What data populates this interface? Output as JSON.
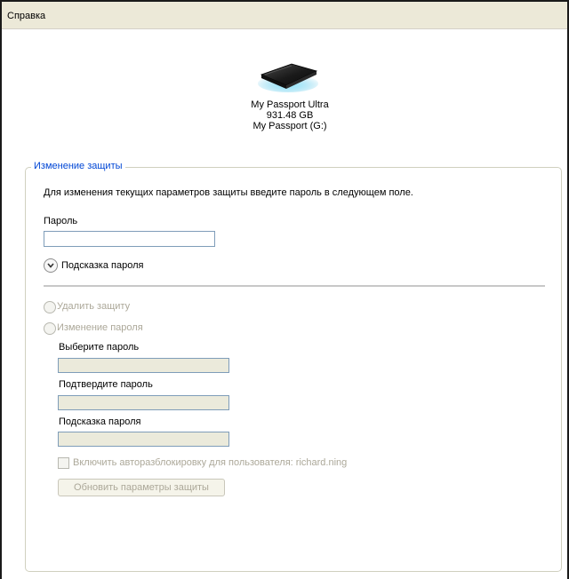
{
  "menu": {
    "help_label": "Справка"
  },
  "device": {
    "model": "My Passport Ultra",
    "capacity": "931.48 GB",
    "volume": "My Passport (G:)"
  },
  "security": {
    "group_title": "Изменение защиты",
    "instruction": "Для изменения текущих параметров защиты введите пароль в следующем поле.",
    "password_label": "Пароль",
    "password_value": "",
    "hint_toggle_label": "Подсказка пароля",
    "remove_option_label": "Удалить защиту",
    "change_option_label": "Изменение пароля",
    "choose_password_label": "Выберите пароль",
    "confirm_password_label": "Подтвердите пароль",
    "hint_label": "Подсказка пароля",
    "auto_unlock_label": "Включить авторазблокировку для пользователя: richard.ning",
    "update_button_label": "Обновить параметры защиты"
  },
  "colors": {
    "group_title": "#0046d5",
    "disabled_text": "#aca899",
    "disabled_field": "#ebeadb",
    "menubar": "#ece9d8"
  },
  "icons": {
    "drive": "external-drive-icon",
    "hint_toggle": "chevron-down-icon"
  }
}
